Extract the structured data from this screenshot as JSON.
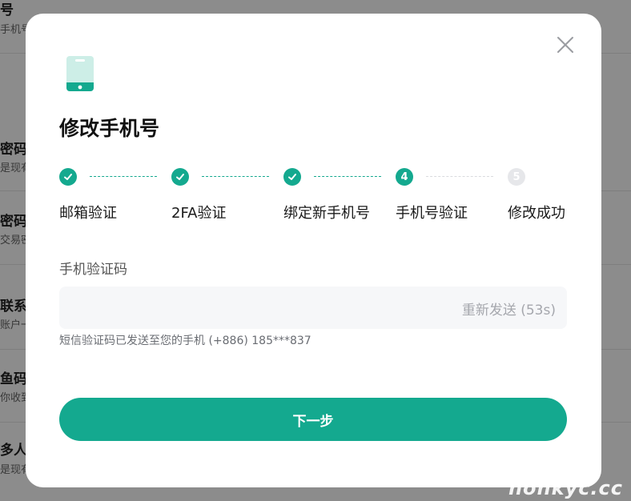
{
  "background": {
    "rows": [
      {
        "title": "号",
        "sub": "手机号"
      },
      {
        "title": "密码",
        "sub": "是现有"
      },
      {
        "title": "密码",
        "sub": "交易密"
      },
      {
        "title": "联系",
        "sub": "账户一"
      },
      {
        "title": "鱼码",
        "sub": "你收到"
      },
      {
        "title": "多人",
        "sub": "是现有"
      }
    ]
  },
  "modal": {
    "title": "修改手机号",
    "steps": [
      {
        "label": "邮箱验证",
        "status": "done",
        "number": ""
      },
      {
        "label": "2FA验证",
        "status": "done",
        "number": ""
      },
      {
        "label": "绑定新手机号",
        "status": "done",
        "number": ""
      },
      {
        "label": "手机号验证",
        "status": "active",
        "number": "4"
      },
      {
        "label": "修改成功",
        "status": "pending",
        "number": "5"
      }
    ],
    "field_label": "手机验证码",
    "code_value": "",
    "resend_label": "重新发送 (53s)",
    "hint": "短信验证码已发送至您的手机 (+886) 185***837",
    "next_button": "下一步"
  },
  "watermark": "nonkyc.cc",
  "colors": {
    "accent": "#14a98f",
    "pending": "#e6e7ea",
    "input_bg": "#f6f7f9"
  }
}
